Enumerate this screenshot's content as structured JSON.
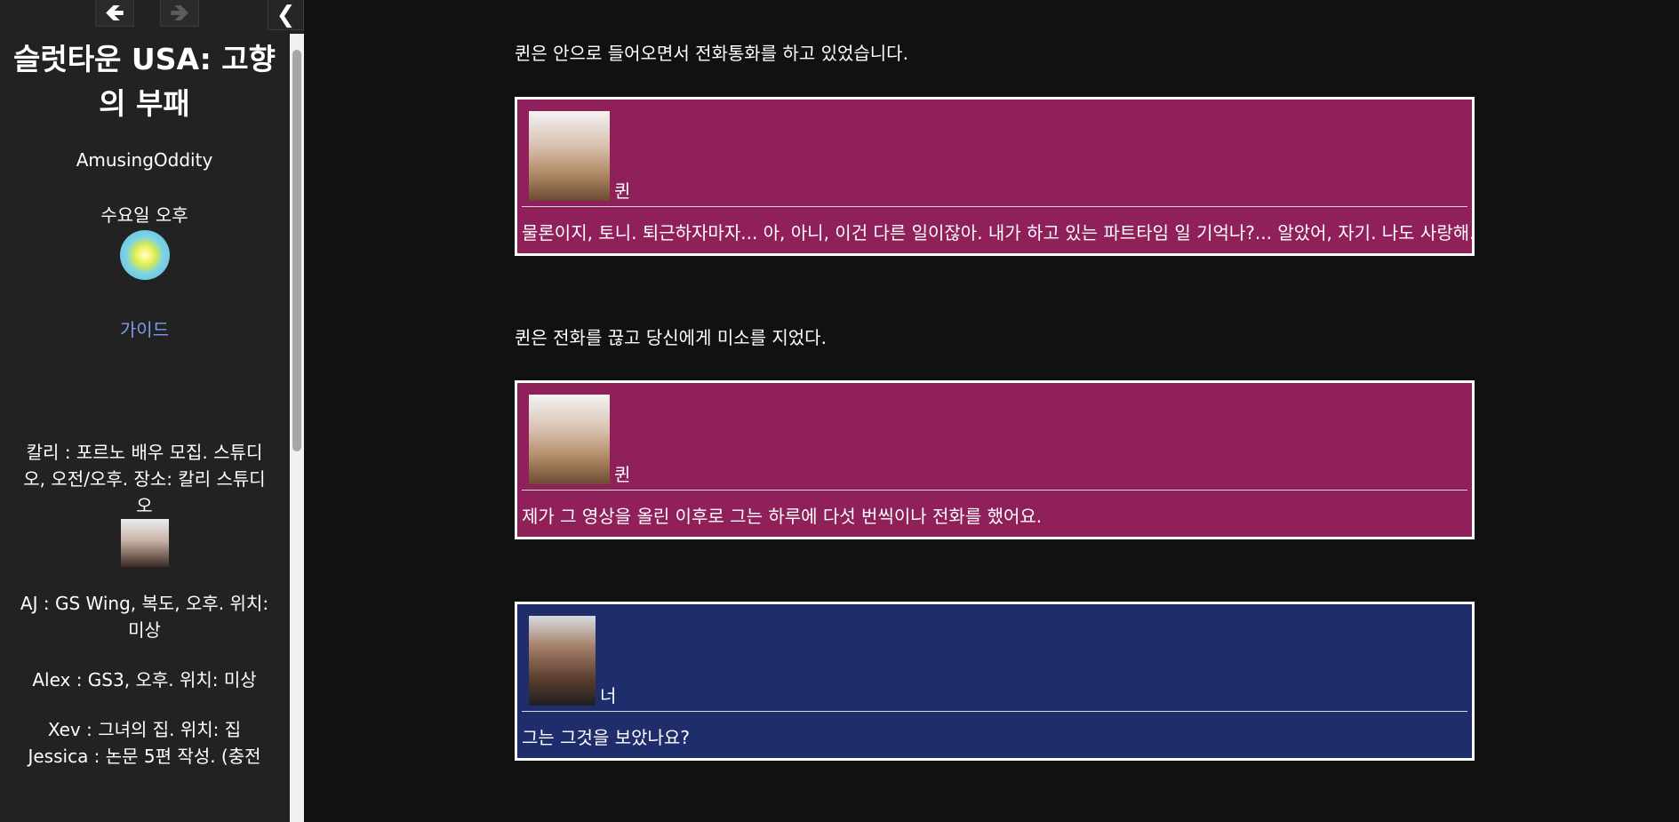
{
  "nav": {
    "back_icon": "arrow-left-icon",
    "forward_icon": "arrow-right-icon",
    "toggle_icon": "chevron-left-icon"
  },
  "sidebar": {
    "title": "슬럿타운 USA: 고향의 부패",
    "author": "AmusingOddity",
    "time": "수요일 오후",
    "guide_label": "가이드",
    "npcs": [
      {
        "text": "칼리 : 포르노 배우 모집. 스튜디오, 오전/오후. 장소: 칼리 스튜디오"
      },
      {
        "text": "AJ : GS Wing, 복도, 오후. 위치: 미상"
      },
      {
        "text": "Alex : GS3, 오후. 위치: 미상"
      },
      {
        "text": "Xev : 그녀의 집. 위치: 집"
      },
      {
        "text": "Jessica : 논문 5편 작성. (충전"
      }
    ]
  },
  "story": {
    "narration_1": "퀸은 안으로 들어오면서 전화통화를 하고 있었습니다.",
    "narration_2": "퀸은 전화를 끊고 당신에게 미소를 지었다.",
    "dialogs": [
      {
        "speaker": "퀸",
        "text": "물론이지, 토니. 퇴근하자마자... 아, 아니, 이건 다른 일이잖아. 내가 하고 있는 파트타임 일 기억나?... 알았어, 자기. 나도 사랑해."
      },
      {
        "speaker": "퀸",
        "text": "제가 그 영상을 올린 이후로 그는 하루에 다섯 번씩이나 전화를 했어요."
      },
      {
        "speaker": "너",
        "text": "그는 그것을 보았나요?"
      }
    ]
  },
  "colors": {
    "page_bg": "#111111",
    "sidebar_bg": "#222222",
    "quinn_box": "#8f205a",
    "player_box": "#202d6c",
    "link": "#7d9cf0"
  }
}
